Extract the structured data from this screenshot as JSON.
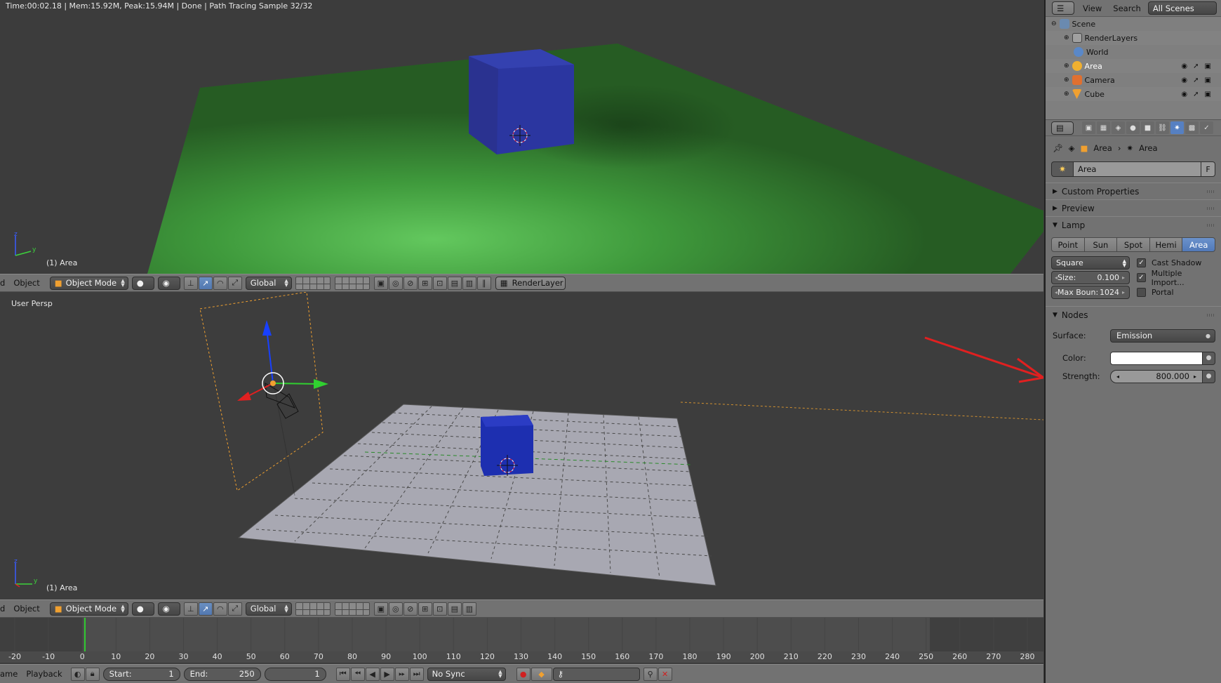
{
  "render_view": {
    "status": "Time:00:02.18 | Mem:15.92M, Peak:15.94M | Done | Path Tracing Sample 32/32",
    "object_label": "(1) Area"
  },
  "top_header": {
    "menu_view": "d",
    "menu_object": "Object",
    "mode": "Object Mode",
    "orientation": "Global",
    "render_layer": "RenderLayer"
  },
  "persp_view": {
    "view_label": "User Persp",
    "object_label": "(1) Area"
  },
  "bottom_header": {
    "menu_view": "d",
    "menu_object": "Object",
    "mode": "Object Mode",
    "orientation": "Global"
  },
  "timeline": {
    "current_frame_marker": 0,
    "ticks": [
      "-20",
      "-10",
      "0",
      "10",
      "20",
      "30",
      "40",
      "50",
      "60",
      "70",
      "80",
      "90",
      "100",
      "110",
      "120",
      "130",
      "140",
      "150",
      "160",
      "170",
      "180",
      "190",
      "200",
      "210",
      "220",
      "230",
      "240",
      "250",
      "260",
      "270",
      "280"
    ],
    "menu_frame": "ame",
    "menu_playback": "Playback",
    "start_label": "Start:",
    "start_value": "1",
    "end_label": "End:",
    "end_value": "250",
    "current_frame": "1",
    "sync": "No Sync"
  },
  "outliner": {
    "menu_view": "View",
    "menu_search": "Search",
    "scenes_dropdown": "All Scenes",
    "rows": [
      {
        "name": "Scene",
        "indent": 0
      },
      {
        "name": "RenderLayers",
        "indent": 1
      },
      {
        "name": "World",
        "indent": 1
      },
      {
        "name": "Area",
        "indent": 1
      },
      {
        "name": "Camera",
        "indent": 1
      },
      {
        "name": "Cube",
        "indent": 1
      }
    ]
  },
  "properties": {
    "breadcrumb_object": "Area",
    "breadcrumb_data": "Area",
    "datablock_name": "Area",
    "datablock_fake": "F",
    "panel_custom_properties": "Custom Properties",
    "panel_preview": "Preview",
    "panel_lamp": "Lamp",
    "lamp_types": [
      "Point",
      "Sun",
      "Spot",
      "Hemi",
      "Area"
    ],
    "lamp_type_selected": "Area",
    "shape": "Square",
    "size_label": "Size:",
    "size_value": "0.100",
    "max_bounces_label": "Max Boun:",
    "max_bounces_value": "1024",
    "cast_shadow": "Cast Shadow",
    "multiple_importance": "Multiple Import...",
    "portal": "Portal",
    "panel_nodes": "Nodes",
    "surface_label": "Surface:",
    "surface_value": "Emission",
    "color_label": "Color:",
    "color_value": "#ffffff",
    "strength_label": "Strength:",
    "strength_value": "800.000"
  },
  "colors": {
    "viewport_bg": "#3c3c3c",
    "header": "#727272",
    "selection_blue": "#5680c2",
    "annotation_arrow": "#e02020"
  }
}
